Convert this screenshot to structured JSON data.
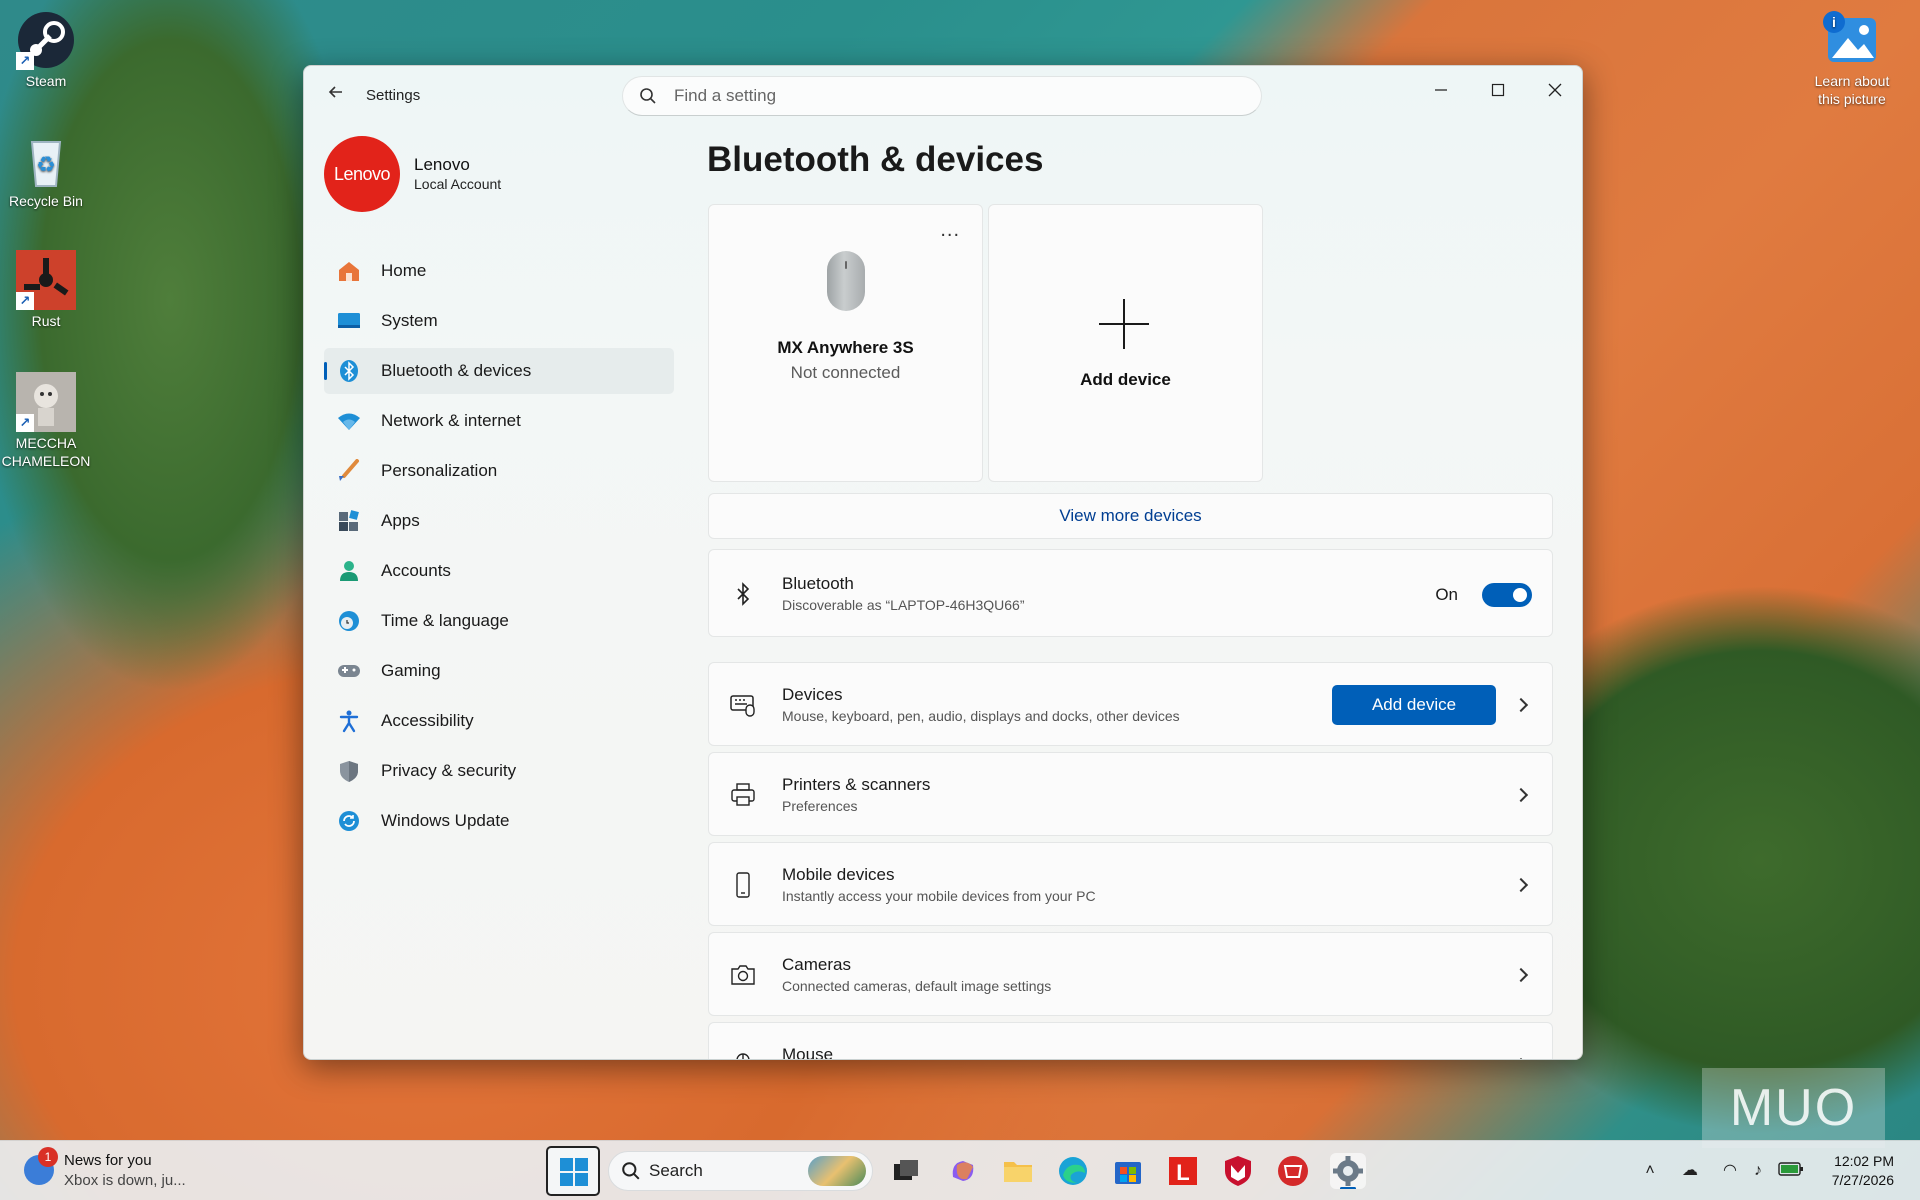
{
  "desktop": {
    "icons": [
      {
        "label": "Steam"
      },
      {
        "label": "Recycle Bin"
      },
      {
        "label": "Rust"
      },
      {
        "label": "MECCHA CHAMELEON"
      }
    ],
    "spotlight_label": "Learn about this picture",
    "watermark": "MUO"
  },
  "window": {
    "app_title": "Settings",
    "search_placeholder": "Find a setting",
    "profile": {
      "avatar_text": "Lenovo",
      "name": "Lenovo",
      "account_type": "Local Account"
    },
    "nav": [
      {
        "label": "Home",
        "icon": "home-icon",
        "color": "#e8753a"
      },
      {
        "label": "System",
        "icon": "system-icon",
        "color": "#1e8fd6"
      },
      {
        "label": "Bluetooth & devices",
        "icon": "bluetooth-icon",
        "color": "#1e8fd6",
        "active": true
      },
      {
        "label": "Network & internet",
        "icon": "wifi-icon",
        "color": "#1e8fd6"
      },
      {
        "label": "Personalization",
        "icon": "brush-icon",
        "color": "#e08a3c"
      },
      {
        "label": "Apps",
        "icon": "apps-icon",
        "color": "#3a4a5a"
      },
      {
        "label": "Accounts",
        "icon": "accounts-icon",
        "color": "#2bb38a"
      },
      {
        "label": "Time & language",
        "icon": "globe-clock-icon",
        "color": "#1e8fd6"
      },
      {
        "label": "Gaming",
        "icon": "gamepad-icon",
        "color": "#7a8590"
      },
      {
        "label": "Accessibility",
        "icon": "accessibility-icon",
        "color": "#1e6fd6"
      },
      {
        "label": "Privacy & security",
        "icon": "shield-icon",
        "color": "#7a8590"
      },
      {
        "label": "Windows Update",
        "icon": "update-icon",
        "color": "#1e8fd6"
      }
    ],
    "page_title": "Bluetooth & devices",
    "device_cards": [
      {
        "name": "MX Anywhere 3S",
        "status": "Not connected",
        "more": "..."
      },
      {
        "label": "Add device"
      }
    ],
    "view_more": "View more devices",
    "bluetooth": {
      "title": "Bluetooth",
      "subtitle": "Discoverable as “LAPTOP-46H3QU66”",
      "state": "On"
    },
    "rows": [
      {
        "title": "Devices",
        "subtitle": "Mouse, keyboard, pen, audio, displays and docks, other devices",
        "button": "Add device"
      },
      {
        "title": "Printers & scanners",
        "subtitle": "Preferences"
      },
      {
        "title": "Mobile devices",
        "subtitle": "Instantly access your mobile devices from your PC"
      },
      {
        "title": "Cameras",
        "subtitle": "Connected cameras, default image settings"
      },
      {
        "title": "Mouse",
        "subtitle": ""
      }
    ],
    "accent_color": "#005fb8"
  },
  "taskbar": {
    "news_title": "News for you",
    "news_sub": "Xbox is down, ju...",
    "news_badge": "1",
    "search_label": "Search",
    "time": "12:02 PM",
    "date": "7/27/2026"
  }
}
